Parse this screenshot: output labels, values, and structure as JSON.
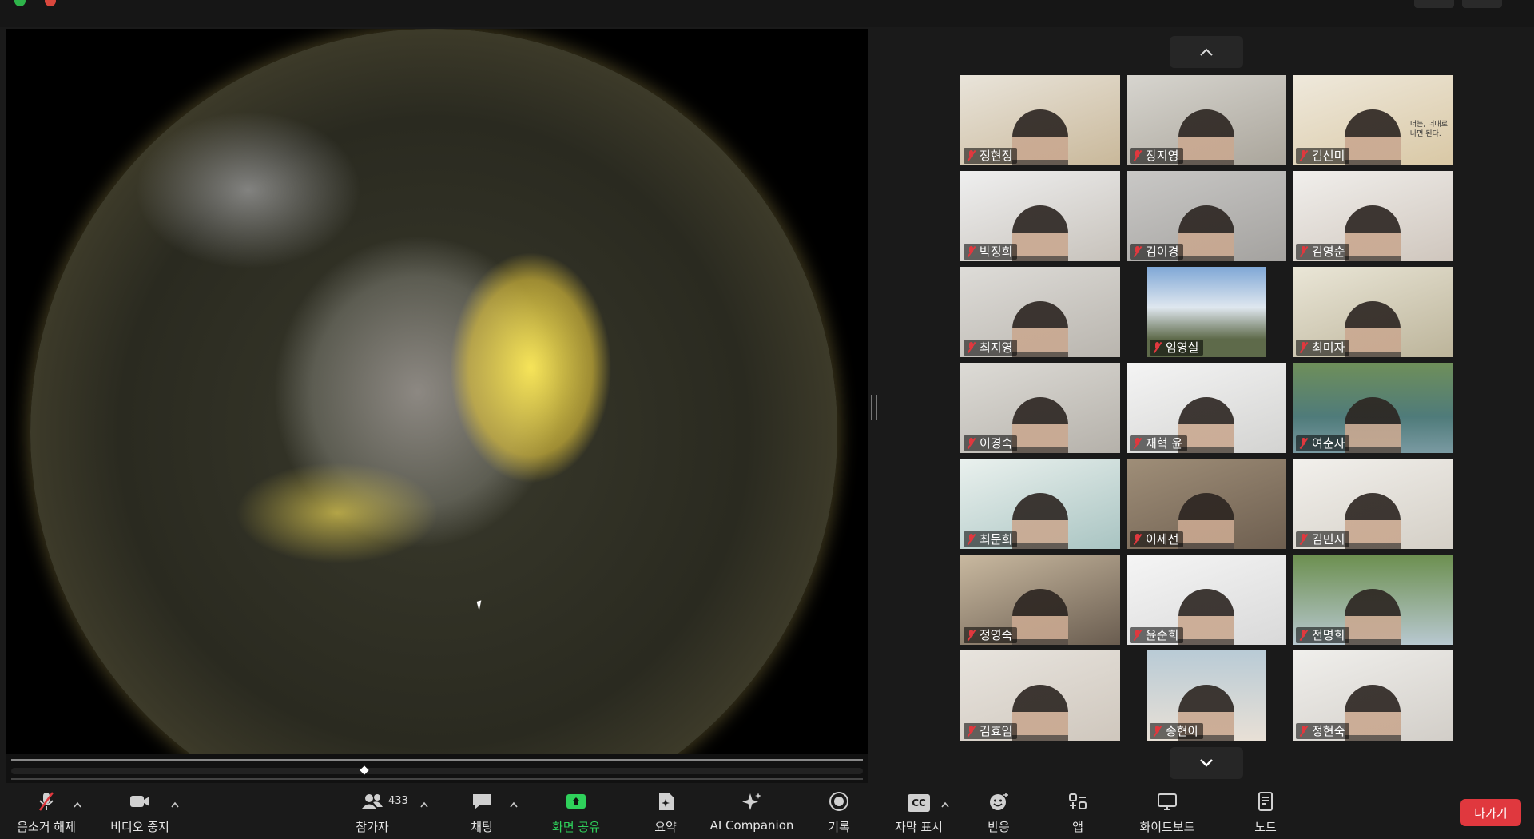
{
  "gallery": {
    "participants": [
      {
        "name": "정현정"
      },
      {
        "name": "장지영"
      },
      {
        "name": "김선미"
      },
      {
        "name": "박정희"
      },
      {
        "name": "김이경"
      },
      {
        "name": "김영순"
      },
      {
        "name": "최지영"
      },
      {
        "name": "임영실"
      },
      {
        "name": "최미자"
      },
      {
        "name": "이경숙"
      },
      {
        "name": "재혁 윤"
      },
      {
        "name": "여춘자"
      },
      {
        "name": "최문희"
      },
      {
        "name": "이제선"
      },
      {
        "name": "김민지"
      },
      {
        "name": "정영숙"
      },
      {
        "name": "윤순희"
      },
      {
        "name": "전명희"
      },
      {
        "name": "김효임"
      },
      {
        "name": "송현아"
      },
      {
        "name": "정현숙"
      }
    ],
    "tile_backdrop_text": "너는, 너대로\n나면 된다."
  },
  "toolbar": {
    "unmute": "음소거 해제",
    "stop_video": "비디오 중지",
    "participants": "참가자",
    "participant_count": "433",
    "chat": "채팅",
    "share_screen": "화면 공유",
    "summary": "요약",
    "ai_companion": "AI Companion",
    "record": "기록",
    "captions": "자막 표시",
    "captions_badge": "CC",
    "reactions": "반응",
    "apps": "앱",
    "whiteboard": "화이트보드",
    "notes": "노트",
    "leave": "나가기"
  },
  "colors": {
    "leave": "#e0383e",
    "share_green": "#2fd15b",
    "mic_off_red": "#e0383e"
  }
}
